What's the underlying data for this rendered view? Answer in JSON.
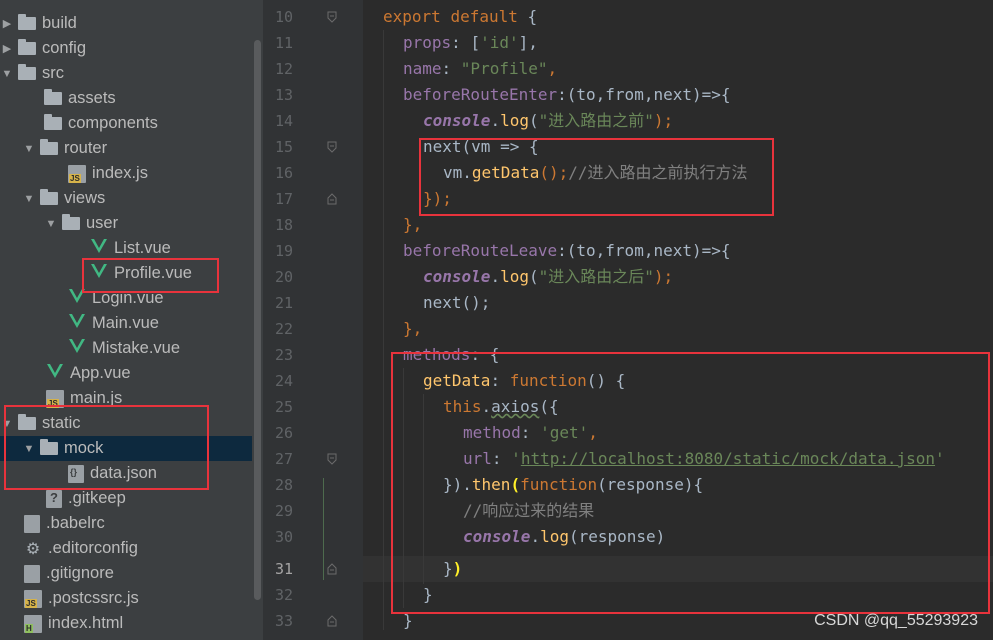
{
  "tree": {
    "items": [
      {
        "label": "build",
        "type": "folder",
        "expanded": false
      },
      {
        "label": "config",
        "type": "folder",
        "expanded": false
      },
      {
        "label": "src",
        "type": "folder",
        "expanded": true
      },
      {
        "label": "assets",
        "type": "folder"
      },
      {
        "label": "components",
        "type": "folder"
      },
      {
        "label": "router",
        "type": "folder",
        "expanded": true
      },
      {
        "label": "index.js",
        "type": "js"
      },
      {
        "label": "views",
        "type": "folder",
        "expanded": true
      },
      {
        "label": "user",
        "type": "folder",
        "expanded": true
      },
      {
        "label": "List.vue",
        "type": "vue"
      },
      {
        "label": "Profile.vue",
        "type": "vue"
      },
      {
        "label": "Login.vue",
        "type": "vue"
      },
      {
        "label": "Main.vue",
        "type": "vue"
      },
      {
        "label": "Mistake.vue",
        "type": "vue"
      },
      {
        "label": "App.vue",
        "type": "vue"
      },
      {
        "label": "main.js",
        "type": "js"
      },
      {
        "label": "static",
        "type": "folder",
        "expanded": true
      },
      {
        "label": "mock",
        "type": "folder",
        "expanded": true
      },
      {
        "label": "data.json",
        "type": "json"
      },
      {
        "label": ".gitkeep",
        "type": "generic"
      },
      {
        "label": ".babelrc",
        "type": "generic"
      },
      {
        "label": ".editorconfig",
        "type": "gear"
      },
      {
        "label": ".gitignore",
        "type": "generic"
      },
      {
        "label": ".postcssrc.js",
        "type": "js"
      },
      {
        "label": "index.html",
        "type": "html"
      }
    ]
  },
  "editor": {
    "line_numbers": [
      "10",
      "11",
      "12",
      "13",
      "14",
      "15",
      "16",
      "17",
      "18",
      "19",
      "20",
      "21",
      "22",
      "23",
      "24",
      "25",
      "26",
      "27",
      "28",
      "29",
      "30",
      "31",
      "32",
      "33"
    ],
    "current_line": "31",
    "code": {
      "l10_a": "export",
      "l10_b": "default",
      "l10_c": " {",
      "l11_a": "props",
      "l11_b": ": [",
      "l11_c": "'id'",
      "l11_d": "],",
      "l12_a": "name",
      "l12_b": ": ",
      "l12_c": "\"Profile\"",
      "l12_d": ",",
      "l13_a": "beforeRouteEnter",
      "l13_b": ":(to,from,next)=>{",
      "l14_a": "console",
      "l14_b": ".",
      "l14_c": "log",
      "l14_d": "(",
      "l14_e": "\"进入路由之前\"",
      "l14_f": ");",
      "l15_a": "next(vm => {",
      "l16_a": "vm.",
      "l16_b": "getData",
      "l16_c": "();",
      "l16_d": "//进入路由之前执行方法",
      "l17_a": "});",
      "l18_a": "},",
      "l19_a": "beforeRouteLeave",
      "l19_b": ":(to,from,next)=>{",
      "l20_a": "console",
      "l20_b": ".",
      "l20_c": "log",
      "l20_d": "(",
      "l20_e": "\"进入路由之后\"",
      "l20_f": ");",
      "l21_a": "next();",
      "l22_a": "},",
      "l23_a": "methods",
      "l23_b": ": {",
      "l24_a": "getData",
      "l24_b": ": ",
      "l24_c": "function",
      "l24_d": "() {",
      "l25_a": "this",
      "l25_b": ".",
      "l25_c": "axios",
      "l25_d": "({",
      "l26_a": "method",
      "l26_b": ": ",
      "l26_c": "'get'",
      "l26_d": ",",
      "l27_a": "url",
      "l27_b": ": ",
      "l27_c": "'",
      "l27_d": "http://localhost:8080/static/mock/data.json",
      "l27_e": "'",
      "l28_a": "}).",
      "l28_b": "then",
      "l28_c": "(",
      "l28_d": "function",
      "l28_e": "(response){",
      "l29_a": "//响应过来的结果",
      "l30_a": "console",
      "l30_b": ".",
      "l30_c": "log",
      "l30_d": "(response)",
      "l31_a": "}",
      "l31_b": ")",
      "l32_a": "}",
      "l33_a": "}"
    }
  },
  "watermark": "CSDN @qq_55293923",
  "colors": {
    "highlight_box": "#e8333c",
    "vue_green": "#41b883",
    "keyword": "#cc7832",
    "string": "#6a8759",
    "function": "#ffc66d",
    "property": "#9876aa"
  }
}
